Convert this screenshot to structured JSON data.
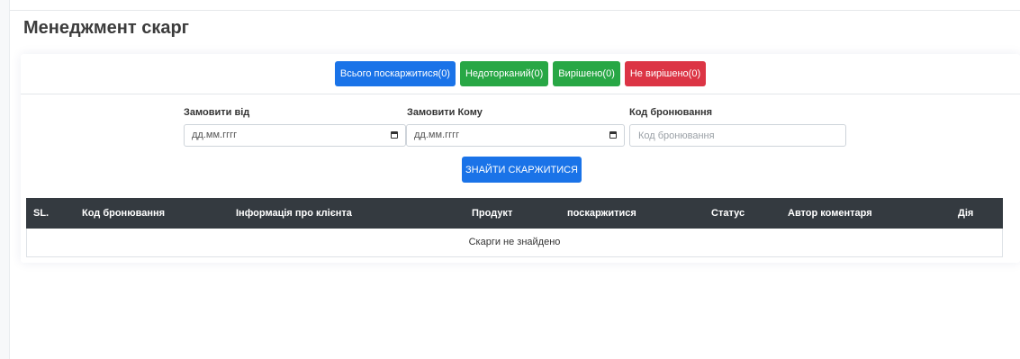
{
  "page": {
    "title": "Менеджмент скарг"
  },
  "status_buttons": [
    {
      "label": "Всього поскаржитися(0)",
      "color": "#1a73e8"
    },
    {
      "label": "Недоторканий(0)",
      "color": "#28a745"
    },
    {
      "label": "Вирішено(0)",
      "color": "#28a745"
    },
    {
      "label": "Не вирішено(0)",
      "color": "#dc3545"
    }
  ],
  "filters": {
    "from_label": "Замовити від",
    "from_value": "дд.мм.гггг",
    "to_label": "Замовити Кому",
    "to_value": "дд.мм.гггг",
    "booking_label": "Код бронювання",
    "booking_placeholder": "Код бронювання",
    "search_label": "ЗНАЙТИ СКАРЖИТИСЯ"
  },
  "table": {
    "columns": [
      "SL.",
      "Код бронювання",
      "Інформація про клієнта",
      "Продукт",
      "поскаржитися",
      "Статус",
      "Автор коментаря",
      "Дія"
    ],
    "empty_message": "Скарги не знайдено"
  }
}
